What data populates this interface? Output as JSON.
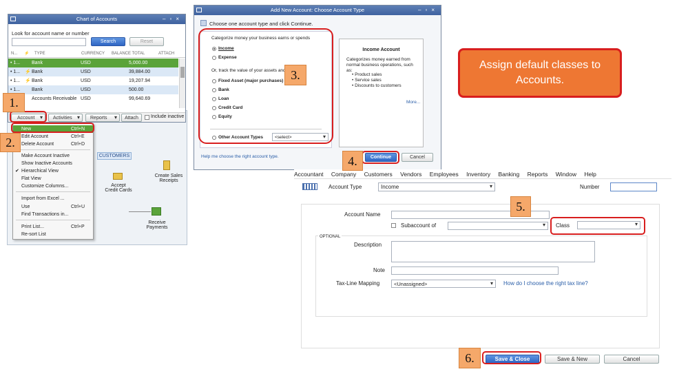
{
  "chart_of_accounts": {
    "title": "Chart of Accounts",
    "look_for_label": "Look for account name or number",
    "search_label": "Search",
    "reset_label": "Reset",
    "columns": [
      "N...",
      "TYPE",
      "CURRENCY",
      "BALANCE TOTAL",
      "ATTACH"
    ],
    "rows": [
      {
        "n": "• 1...",
        "type": "Bank",
        "currency": "USD",
        "balance": "5,000.00",
        "selected": true
      },
      {
        "n": "• 1...",
        "type": "Bank",
        "currency": "USD",
        "balance": "39,884.00"
      },
      {
        "n": "• 1...",
        "type": "Bank",
        "currency": "USD",
        "balance": "19,207.94"
      },
      {
        "n": "• 1...",
        "type": "Bank",
        "currency": "USD",
        "balance": "500.00"
      },
      {
        "n": "",
        "type": "Accounts Receivable",
        "currency": "USD",
        "balance": "99,640.69"
      }
    ],
    "bottom": {
      "account": "Account",
      "activities": "Activities",
      "reports": "Reports",
      "attach": "Attach",
      "include_inactive": "Include inactive"
    }
  },
  "account_menu": {
    "items": [
      {
        "label": "New",
        "shortcut": "Ctrl+N",
        "highlight": true
      },
      {
        "label": "Edit Account",
        "shortcut": "Ctrl+E"
      },
      {
        "label": "Delete Account",
        "shortcut": "Ctrl+D"
      },
      {
        "label": "Make Account Inactive",
        "shortcut": ""
      },
      {
        "label": "Show Inactive Accounts",
        "shortcut": ""
      },
      {
        "label": "Hierarchical View",
        "shortcut": "",
        "checked": true
      },
      {
        "label": "Flat View",
        "shortcut": ""
      },
      {
        "label": "Customize Columns...",
        "shortcut": ""
      },
      {
        "label": "Import from Excel ...",
        "shortcut": ""
      },
      {
        "label": "Use",
        "shortcut": "Ctrl+U"
      },
      {
        "label": "Find Transactions in...",
        "shortcut": ""
      },
      {
        "label": "Print List...",
        "shortcut": "Ctrl+P"
      },
      {
        "label": "Re-sort List",
        "shortcut": ""
      }
    ]
  },
  "home_bg": {
    "customers_tab": "CUSTOMERS",
    "accept_credit_cards": "Accept\nCredit Cards",
    "create_sales_receipts": "Create Sales\nReceipts",
    "receive_payments": "Receive\nPayments"
  },
  "add_account": {
    "title": "Add New Account: Choose Account Type",
    "instruction": "Choose one account type and click Continue.",
    "categorize_label": "Categorize money your business earns or spends",
    "options_primary": [
      "Income",
      "Expense"
    ],
    "track_label": "Or, track the value of your assets and liab",
    "options_secondary": [
      "Fixed Asset (major purchases)",
      "Bank",
      "Loan",
      "Credit Card",
      "Equity"
    ],
    "other_label": "Other Account Types",
    "other_select": "<select>",
    "info_title": "Income Account",
    "info_text": "Categorizes money earned from normal business operations, such as:",
    "info_bullets": [
      "• Product sales",
      "• Service sales",
      "• Discounts to customers"
    ],
    "more_link": "More...",
    "help_link": "Help me choose the right account type.",
    "continue_label": "Continue",
    "cancel_label": "Cancel"
  },
  "new_account_form": {
    "menubar": [
      "Accountant",
      "Company",
      "Customers",
      "Vendors",
      "Employees",
      "Inventory",
      "Banking",
      "Reports",
      "Window",
      "Help"
    ],
    "account_type_label": "Account Type",
    "account_type_value": "Income",
    "number_label": "Number",
    "account_name_label": "Account Name",
    "subaccount_label": "Subaccount of",
    "class_label": "Class",
    "optional_label": "OPTIONAL",
    "description_label": "Description",
    "note_label": "Note",
    "tax_line_label": "Tax-Line Mapping",
    "tax_line_value": "<Unassigned>",
    "tax_help_link": "How do I choose the right tax line?",
    "save_close_label": "Save & Close",
    "save_new_label": "Save & New",
    "cancel_label": "Cancel"
  },
  "steps": [
    "1.",
    "2.",
    "3.",
    "4.",
    "5.",
    "6."
  ],
  "callout": {
    "text": "Assign default classes to Accounts.",
    "color": "#ee7733"
  },
  "colors": {
    "highlight_green": "#5aa33a",
    "annotation_red": "#d81e1e",
    "step_orange": "#f5a86a",
    "title_blue": "#4a6fad"
  }
}
